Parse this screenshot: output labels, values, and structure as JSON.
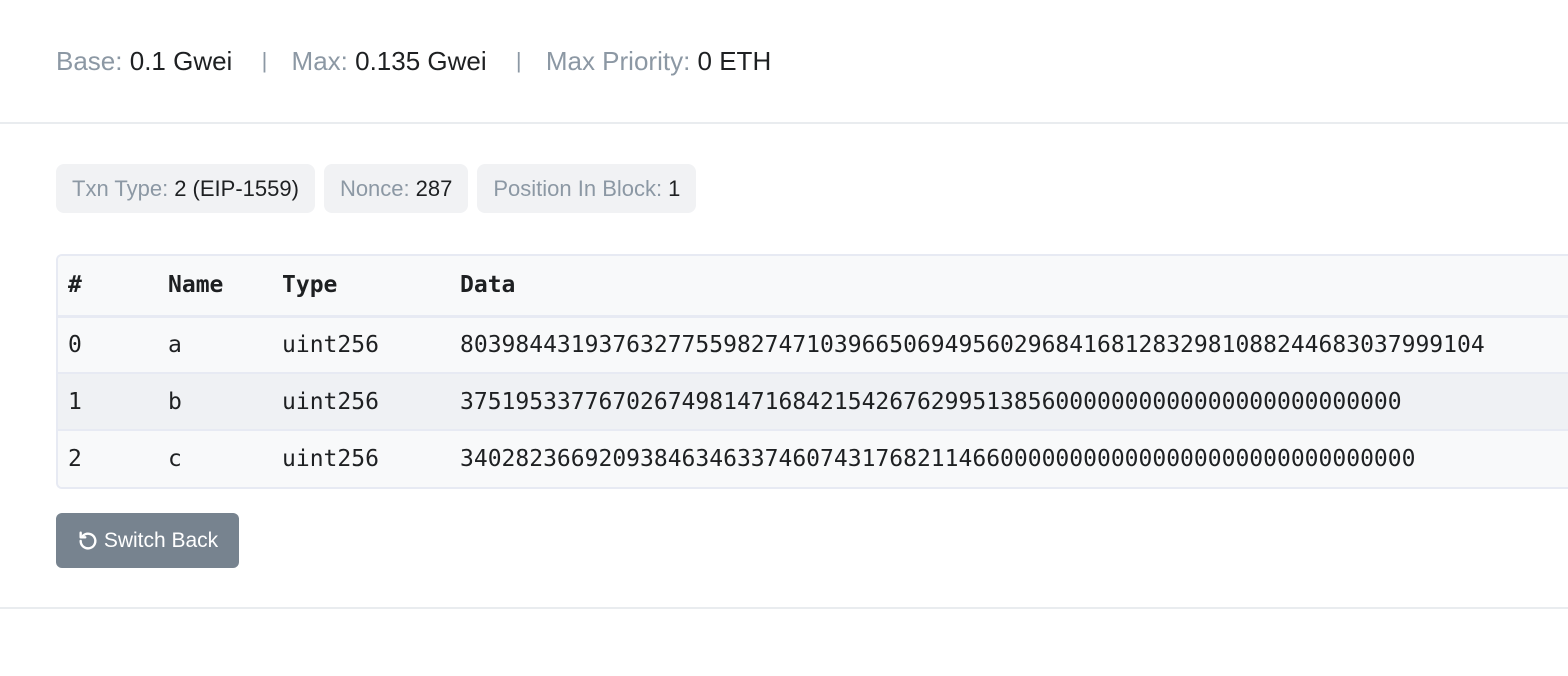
{
  "gas": {
    "base_label": "Base:",
    "base_value": "0.1 Gwei",
    "max_label": "Max:",
    "max_value": "0.135 Gwei",
    "priority_label": "Max Priority:",
    "priority_value": "0 ETH",
    "separator": "|"
  },
  "badges": {
    "txn_type_label": "Txn Type:",
    "txn_type_value": "2 (EIP-1559)",
    "nonce_label": "Nonce:",
    "nonce_value": "287",
    "position_label": "Position In Block:",
    "position_value": "1"
  },
  "table": {
    "headers": [
      "#",
      "Name",
      "Type",
      "Data"
    ],
    "rows": [
      [
        "0",
        "a",
        "uint256",
        "80398443193763277559827471039665069495602968416812832981088244683037999104"
      ],
      [
        "1",
        "b",
        "uint256",
        "37519533776702674981471684215426762995138560000000000000000000000000"
      ],
      [
        "2",
        "c",
        "uint256",
        "340282366920938463463374607431768211466000000000000000000000000000000"
      ]
    ]
  },
  "actions": {
    "switch_back_label": "Switch Back",
    "switch_back_icon": "undo-icon"
  },
  "colors": {
    "label_gray": "#8c98a4",
    "text_dark": "#1e2022",
    "button_bg": "#77838f",
    "badge_bg": "#f1f2f4"
  }
}
